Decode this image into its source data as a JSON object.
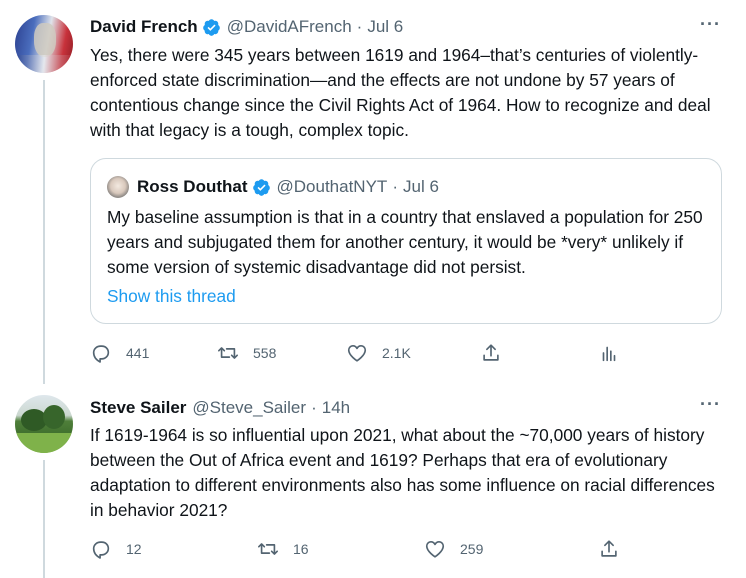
{
  "tweet1": {
    "name": "David French",
    "handle": "@DavidAFrench",
    "separator": "·",
    "date": "Jul 6",
    "text": "Yes, there were 345 years between 1619 and 1964–that’s centuries of violently-enforced state discrimination—and the effects are not undone by 57 years of contentious change since the Civil Rights Act of 1964. How to recognize and deal with that legacy is a tough, complex topic.",
    "quote": {
      "name": "Ross Douthat",
      "handle": "@DouthatNYT",
      "separator": "·",
      "date": "Jul 6",
      "text": "My baseline assumption is that in a country that enslaved a population for 250 years and subjugated them for another century, it would be *very* unlikely if some version of systemic disadvantage did not persist.",
      "link": "Show this thread"
    },
    "replies": "441",
    "retweets": "558",
    "likes": "2.1K"
  },
  "tweet2": {
    "name": "Steve Sailer",
    "handle": "@Steve_Sailer",
    "separator": "·",
    "date": "14h",
    "text": "If 1619-1964 is so influential upon 2021, what about the ~70,000 years of history between the Out of Africa event and 1619? Perhaps that era of evolutionary adaptation to different environments also has some influence on racial differences in behavior 2021?",
    "replies": "12",
    "retweets": "16",
    "likes": "259"
  },
  "more_label": "···",
  "colors": {
    "accent": "#1d9bf0",
    "text": "#0f1419",
    "muted": "#536471",
    "border": "#cfd9de"
  },
  "icons": [
    "verified-icon",
    "reply-icon",
    "retweet-icon",
    "like-icon",
    "share-icon",
    "analytics-icon",
    "more-icon"
  ]
}
